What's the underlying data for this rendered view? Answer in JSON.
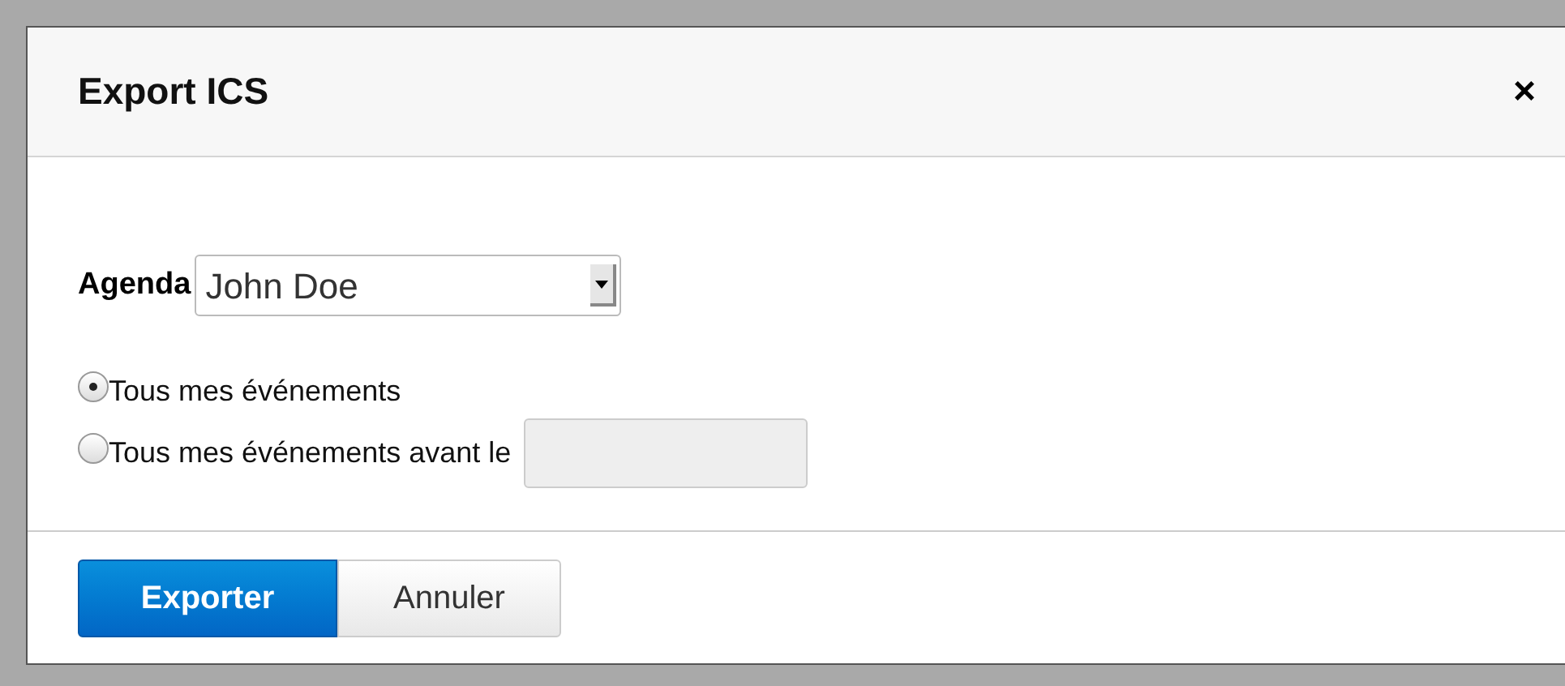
{
  "dialog": {
    "title": "Export ICS",
    "close": "×"
  },
  "agenda": {
    "label": "Agenda",
    "value": "John Doe"
  },
  "options": [
    {
      "label": "Tous mes événements",
      "selected": true,
      "kind": "plain"
    },
    {
      "label": "Tous mes événements avant le",
      "selected": false,
      "kind": "date"
    }
  ],
  "buttons": [
    {
      "label": "Exporter",
      "kind": "primary"
    },
    {
      "label": "Annuler",
      "kind": "secondary"
    }
  ]
}
